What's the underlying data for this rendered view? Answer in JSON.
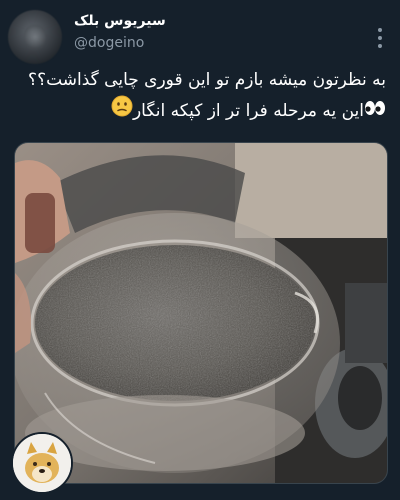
{
  "tweet": {
    "display_name": "سیریوس بلک",
    "handle": "@dogeino",
    "text_line1": "به نظرتون میشه بازم تو این قوری چایی گذاشت؟؟",
    "text_line2": "این یه مرحله فرا تر از کپکه انگار",
    "icons": {
      "avatar": "profile-avatar-blurred",
      "more": "more-vertical-icon",
      "emoji_eyes": "eyes-emoji",
      "emoji_face": "sick-face-emoji",
      "bottom_avatar": "doge-avatar"
    }
  },
  "colors": {
    "background": "#15202b",
    "text": "#ffffff",
    "secondary": "#8b98a5",
    "border": "#38444d"
  }
}
